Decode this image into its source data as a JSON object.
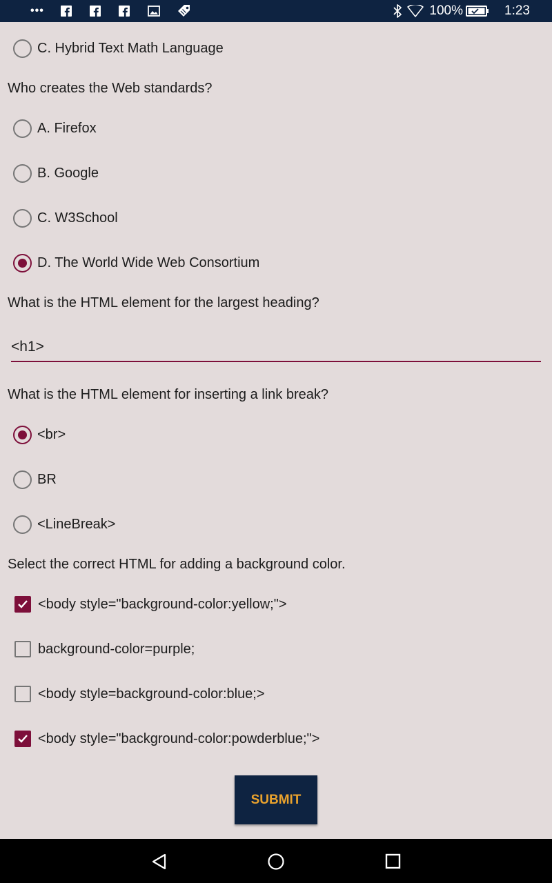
{
  "status_bar": {
    "battery": "100%",
    "time": "1:23"
  },
  "quiz": {
    "q1_tail_option": {
      "label": "C. Hybrid Text Math Language",
      "selected": false
    },
    "q2": {
      "question": "Who creates the Web standards?",
      "options": [
        {
          "label": "A. Firefox",
          "selected": false
        },
        {
          "label": "B. Google",
          "selected": false
        },
        {
          "label": "C. W3School",
          "selected": false
        },
        {
          "label": "D. The World Wide Web Consortium",
          "selected": true
        }
      ]
    },
    "q3": {
      "question": "What is the HTML element for the largest heading?",
      "answer": "<h1>"
    },
    "q4": {
      "question": "What is the HTML element for inserting a link break?",
      "options": [
        {
          "label": "<br>",
          "selected": true
        },
        {
          "label": "BR",
          "selected": false
        },
        {
          "label": "<LineBreak>",
          "selected": false
        }
      ]
    },
    "q5": {
      "question": "Select the correct HTML for adding a background color.",
      "options": [
        {
          "label": "<body style=\"background-color:yellow;\">",
          "checked": true
        },
        {
          "label": "background-color=purple;",
          "checked": false
        },
        {
          "label": "<body style=background-color:blue;>",
          "checked": false
        },
        {
          "label": "<body style=\"background-color:powderblue;\">",
          "checked": true
        }
      ]
    },
    "submit_label": "SUBMIT"
  },
  "colors": {
    "accent": "#7d0f3a",
    "bars": "#0e2341",
    "background": "#e3dbdb",
    "submit_text": "#e9a22d"
  },
  "icons": [
    "more-notifications-icon",
    "facebook-icon",
    "image-icon",
    "tag-icon",
    "bluetooth-icon",
    "wifi-icon",
    "battery-icon",
    "back-icon",
    "home-icon",
    "recents-icon"
  ]
}
